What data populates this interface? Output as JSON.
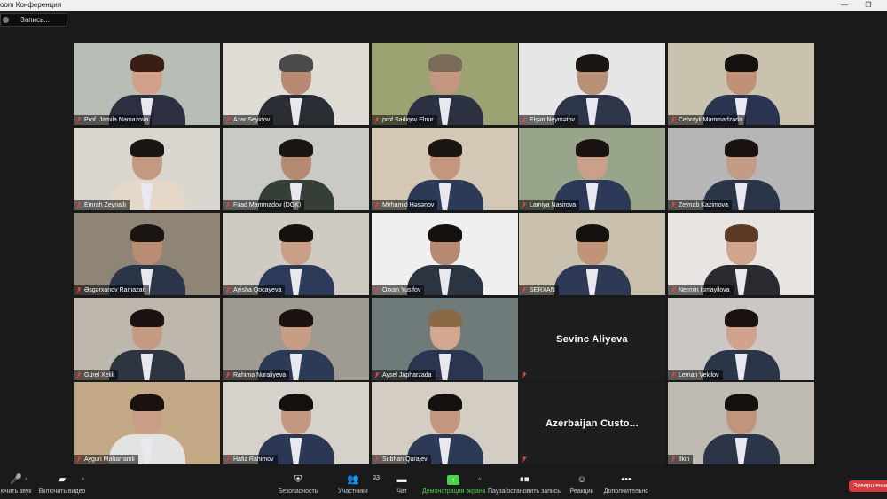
{
  "window": {
    "title": "oom Конференция",
    "restore_glyph": "❐",
    "close_glyph": "✕"
  },
  "recording": {
    "label": "Запись..."
  },
  "participants": [
    {
      "name": "Prof. Jamila Namazova",
      "active": true,
      "bg": "#b8bdb5",
      "skin": "#d2a088",
      "suit": "#2c3040",
      "hair": "#3a1e14"
    },
    {
      "name": "Azar Seyidov",
      "bg": "#e0dcd6",
      "skin": "#b88a72",
      "suit": "#2a2d33",
      "hair": "#4a4a4a"
    },
    {
      "name": "prof.Sadiqov Elnur",
      "bg": "#9da273",
      "skin": "#c49680",
      "suit": "#2d3242",
      "hair": "#7a6a5a"
    },
    {
      "name": "Elşən Neymətov",
      "bg": "#e6e6e6",
      "skin": "#b98f78",
      "suit": "#2d3548",
      "hair": "#1b1512"
    },
    {
      "name": "Cebrayil Mammadzada",
      "bg": "#c9c2ae",
      "skin": "#c09077",
      "suit": "#2a3350",
      "hair": "#14100e"
    },
    {
      "name": "Emrah Zeynallı",
      "bg": "#d9d6d0",
      "skin": "#c49a82",
      "suit": "#e5d8c9",
      "hair": "#1b1512"
    },
    {
      "name": "Fuad Mammadov (DGK)",
      "bg": "#c9c9c5",
      "skin": "#b58a72",
      "suit": "#363f37",
      "hair": "#1b1512"
    },
    {
      "name": "Mirhamid Həsənov",
      "bg": "#d5c7b5",
      "skin": "#c2977e",
      "suit": "#2c3a58",
      "hair": "#1b1512"
    },
    {
      "name": "Lamiya Nasirova",
      "bg": "#98a58a",
      "skin": "#caa08a",
      "suit": "#2b3856",
      "hair": "#1a1210"
    },
    {
      "name": "Zeynab Kazimova",
      "bg": "#b6b6b6",
      "skin": "#c59b85",
      "suit": "#2b3548",
      "hair": "#1a1210"
    },
    {
      "name": "Əsgərxanov Ramazan",
      "bg": "#8e8576",
      "skin": "#b88d74",
      "suit": "#2b3548",
      "hair": "#1b1512"
    },
    {
      "name": "Ayisha Qocayeva",
      "bg": "#cfcbc3",
      "skin": "#c89e87",
      "suit": "#2d3a5a",
      "hair": "#17110e"
    },
    {
      "name": "Orxan Yusifov",
      "bg": "#efefef",
      "skin": "#b58a70",
      "suit": "#2c3442",
      "hair": "#14100e"
    },
    {
      "name": "SERXAN",
      "bg": "#c9c0ae",
      "skin": "#c09479",
      "suit": "#2c3854",
      "hair": "#14100e"
    },
    {
      "name": "Nermin İsmayilova",
      "bg": "#e8e4e2",
      "skin": "#d0a58e",
      "suit": "#2a2a30",
      "hair": "#5a3a25"
    },
    {
      "name": "Gürel Xelili",
      "bg": "#bdb7ad",
      "skin": "#c49a82",
      "suit": "#2c3540",
      "hair": "#1a1210"
    },
    {
      "name": "Rahima Nuraliyeva",
      "bg": "#9f9a92",
      "skin": "#c89d86",
      "suit": "#2d3a55",
      "hair": "#1a1210"
    },
    {
      "name": "Aysel Japharzada",
      "bg": "#6f7a7a",
      "skin": "#d3a890",
      "suit": "#2b3550",
      "hair": "#8a6a45"
    },
    {
      "name": "Sevinc Aliyeva",
      "video": false
    },
    {
      "name": "Leman Vekilov",
      "bg": "#cbc7c4",
      "skin": "#cfa38d",
      "suit": "#2b3548",
      "hair": "#1a1210"
    },
    {
      "name": "Aygun Maharramli",
      "bg": "#c4a986",
      "skin": "#c89e86",
      "suit": "#e3e3e3",
      "hair": "#1a1210"
    },
    {
      "name": "Hafiz Rahimov",
      "bg": "#d6d2cb",
      "skin": "#c39880",
      "suit": "#2c3754",
      "hair": "#14100e"
    },
    {
      "name": "Subhan Qarajev",
      "bg": "#d3cdc3",
      "skin": "#c29680",
      "suit": "#2d3a55",
      "hair": "#14100e"
    },
    {
      "name": "Azerbaijan  Custo...",
      "video": false
    },
    {
      "name": "Ilkin",
      "bg": "#bfbab2",
      "skin": "#c0957d",
      "suit": "#2c3548",
      "hair": "#14100e"
    }
  ],
  "toolbar": {
    "mute": "ючить звук",
    "video": "Включить видео",
    "security": "Безопасность",
    "participants": "Участники",
    "participants_count": "23",
    "chat": "Чат",
    "share": "Демонстрация экрана",
    "record": "Пауза/остановить запись",
    "reactions": "Реакции",
    "more": "Дополнительно",
    "end": "Завершение"
  },
  "colors": {
    "active_speaker": "#c8d652",
    "share_green": "#4cd14c",
    "end_red": "#d83b3b"
  }
}
